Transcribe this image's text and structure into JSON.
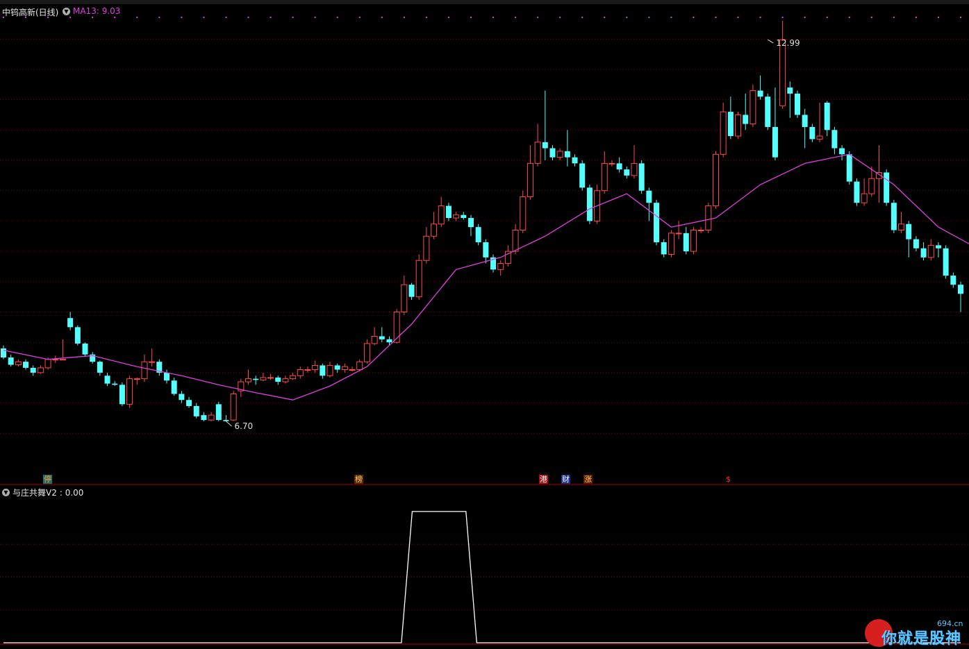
{
  "header": {
    "stock_name": "中钨高新(日线)",
    "ma_label": "MA13: 9.03"
  },
  "colors": {
    "up": "#ff4a4a",
    "down": "#54ffff",
    "ma": "#e040e0",
    "grid": "#8b0000",
    "indicator": "#ffffff"
  },
  "chart_data": [
    {
      "type": "candlestick",
      "series": [
        {
          "name": "MA13"
        }
      ],
      "ylim": [
        6.0,
        13.3
      ],
      "price_scale_step": 0.5,
      "annotations": [
        {
          "label": "12.99",
          "x_index": 103,
          "price": 12.99,
          "kind": "high"
        },
        {
          "label": "6.70",
          "x_index": 30,
          "price": 6.7,
          "kind": "low"
        }
      ],
      "candles": [
        [
          7.9,
          7.75,
          7.95,
          7.72
        ],
        [
          7.75,
          7.63,
          7.8,
          7.6
        ],
        [
          7.63,
          7.68,
          7.72,
          7.6
        ],
        [
          7.68,
          7.58,
          7.72,
          7.55
        ],
        [
          7.58,
          7.5,
          7.62,
          7.45
        ],
        [
          7.5,
          7.58,
          7.62,
          7.48
        ],
        [
          7.58,
          7.72,
          7.75,
          7.55
        ],
        [
          7.72,
          7.72,
          7.78,
          7.66
        ],
        [
          7.72,
          7.72,
          7.75,
          8.05
        ],
        [
          8.4,
          8.25,
          8.5,
          8.2
        ],
        [
          8.25,
          7.98,
          8.28,
          7.95
        ],
        [
          7.98,
          7.8,
          8.0,
          7.76
        ],
        [
          7.8,
          7.68,
          7.84,
          7.65
        ],
        [
          7.68,
          7.5,
          7.7,
          7.45
        ],
        [
          7.45,
          7.32,
          7.5,
          7.28
        ],
        [
          7.32,
          7.3,
          7.36,
          7.28
        ],
        [
          7.3,
          6.98,
          7.34,
          6.95
        ],
        [
          6.98,
          7.4,
          7.45,
          6.92
        ],
        [
          7.4,
          7.4,
          7.42,
          7.3
        ],
        [
          7.4,
          7.68,
          7.8,
          7.35
        ],
        [
          7.68,
          7.68,
          7.9,
          7.6
        ],
        [
          7.68,
          7.5,
          7.72,
          7.45
        ],
        [
          7.5,
          7.37,
          7.55,
          7.32
        ],
        [
          7.37,
          7.15,
          7.42,
          7.12
        ],
        [
          7.15,
          7.05,
          7.2,
          7.0
        ],
        [
          7.05,
          6.95,
          7.1,
          6.92
        ],
        [
          6.95,
          6.78,
          7.0,
          6.75
        ],
        [
          6.8,
          6.72,
          6.85,
          6.7
        ],
        [
          6.72,
          6.8,
          6.85,
          6.7
        ],
        [
          6.98,
          6.72,
          7.02,
          6.7
        ],
        [
          6.72,
          6.7,
          6.8,
          6.7
        ],
        [
          6.72,
          7.15,
          7.2,
          6.7
        ],
        [
          7.2,
          7.35,
          7.4,
          7.1
        ],
        [
          7.35,
          7.4,
          7.55,
          7.3
        ],
        [
          7.4,
          7.38,
          7.45,
          7.3
        ],
        [
          7.38,
          7.42,
          7.5,
          7.36
        ],
        [
          7.42,
          7.42,
          7.48,
          7.38
        ],
        [
          7.42,
          7.35,
          7.45,
          7.3
        ],
        [
          7.35,
          7.4,
          7.45,
          7.32
        ],
        [
          7.4,
          7.45,
          7.5,
          7.38
        ],
        [
          7.45,
          7.55,
          7.6,
          7.4
        ],
        [
          7.55,
          7.55,
          7.6,
          7.5
        ],
        [
          7.55,
          7.62,
          7.7,
          7.5
        ],
        [
          7.62,
          7.45,
          7.65,
          7.4
        ],
        [
          7.45,
          7.62,
          7.68,
          7.42
        ],
        [
          7.62,
          7.55,
          7.65,
          7.5
        ],
        [
          7.55,
          7.6,
          7.65,
          7.5
        ],
        [
          7.55,
          7.55,
          7.6,
          7.52
        ],
        [
          7.55,
          7.68,
          7.72,
          7.52
        ],
        [
          7.68,
          7.98,
          8.05,
          7.65
        ],
        [
          7.98,
          8.1,
          8.25,
          7.95
        ],
        [
          8.1,
          8.05,
          8.25,
          8.0
        ],
        [
          8.05,
          8.0,
          8.1,
          7.95
        ],
        [
          8.0,
          8.5,
          8.55,
          7.98
        ],
        [
          8.5,
          8.95,
          9.1,
          8.45
        ],
        [
          8.95,
          8.75,
          8.98,
          8.7
        ],
        [
          8.75,
          9.35,
          9.45,
          8.7
        ],
        [
          9.35,
          9.75,
          9.9,
          9.3
        ],
        [
          9.75,
          9.95,
          10.15,
          9.7
        ],
        [
          9.95,
          10.25,
          10.4,
          9.9
        ],
        [
          10.25,
          10.05,
          10.3,
          10.0
        ],
        [
          10.05,
          10.1,
          10.15,
          10.0
        ],
        [
          10.1,
          10.05,
          10.15,
          10.02
        ],
        [
          10.05,
          9.9,
          10.1,
          9.75
        ],
        [
          9.9,
          9.65,
          9.95,
          9.6
        ],
        [
          9.65,
          9.4,
          9.7,
          9.3
        ],
        [
          9.4,
          9.2,
          9.45,
          9.15
        ],
        [
          9.2,
          9.3,
          9.35,
          9.1
        ],
        [
          9.3,
          9.5,
          9.6,
          9.25
        ],
        [
          9.5,
          9.85,
          9.95,
          9.45
        ],
        [
          9.85,
          10.4,
          10.5,
          9.8
        ],
        [
          10.4,
          10.95,
          11.25,
          10.35
        ],
        [
          10.95,
          11.3,
          11.6,
          10.9
        ],
        [
          11.3,
          11.2,
          12.15,
          11.0
        ],
        [
          11.2,
          11.05,
          11.25,
          11.0
        ],
        [
          11.05,
          11.15,
          11.2,
          11.0
        ],
        [
          11.15,
          11.05,
          11.5,
          10.9
        ],
        [
          11.05,
          10.95,
          11.1,
          10.9
        ],
        [
          10.95,
          10.55,
          11.0,
          10.5
        ],
        [
          10.55,
          10.0,
          10.6,
          9.95
        ],
        [
          10.0,
          10.5,
          10.6,
          9.95
        ],
        [
          10.5,
          10.95,
          11.15,
          10.45
        ],
        [
          10.95,
          10.95,
          11.0,
          10.9
        ],
        [
          10.95,
          10.85,
          11.05,
          10.8
        ],
        [
          10.85,
          10.75,
          10.9,
          10.7
        ],
        [
          10.75,
          10.95,
          11.25,
          10.7
        ],
        [
          10.95,
          10.5,
          11.0,
          10.45
        ],
        [
          10.5,
          10.3,
          10.55,
          10.0
        ],
        [
          10.3,
          9.65,
          10.35,
          9.6
        ],
        [
          9.65,
          9.45,
          9.7,
          9.4
        ],
        [
          9.45,
          9.8,
          9.85,
          9.4
        ],
        [
          9.8,
          9.8,
          10.0,
          9.7
        ],
        [
          9.8,
          9.5,
          9.9,
          9.45
        ],
        [
          9.5,
          9.85,
          9.9,
          9.45
        ],
        [
          9.85,
          9.85,
          9.9,
          9.8
        ],
        [
          9.85,
          10.25,
          10.3,
          9.8
        ],
        [
          10.25,
          11.1,
          11.15,
          10.2
        ],
        [
          11.1,
          11.8,
          11.95,
          11.05
        ],
        [
          11.8,
          11.4,
          12.05,
          11.35
        ],
        [
          11.4,
          11.75,
          11.8,
          11.35
        ],
        [
          11.75,
          11.6,
          12.1,
          11.5
        ],
        [
          11.6,
          12.15,
          12.25,
          11.55
        ],
        [
          12.15,
          12.05,
          12.4,
          12.0
        ],
        [
          12.05,
          11.55,
          12.1,
          11.5
        ],
        [
          11.55,
          11.05,
          12.2,
          11.0
        ],
        [
          11.9,
          12.99,
          13.3,
          11.85
        ],
        [
          12.2,
          12.1,
          12.3,
          11.7
        ],
        [
          12.1,
          11.75,
          12.15,
          11.7
        ],
        [
          11.75,
          11.55,
          11.85,
          11.2
        ],
        [
          11.55,
          11.35,
          11.6,
          11.3
        ],
        [
          11.35,
          11.4,
          11.95,
          11.3
        ],
        [
          11.95,
          11.5,
          11.98,
          11.4
        ],
        [
          11.5,
          11.2,
          11.55,
          11.1
        ],
        [
          11.2,
          11.1,
          11.25,
          11.0
        ],
        [
          11.1,
          10.65,
          11.15,
          10.6
        ],
        [
          10.65,
          10.3,
          10.7,
          10.25
        ],
        [
          10.3,
          10.45,
          10.7,
          10.25
        ],
        [
          10.45,
          10.7,
          10.9,
          10.4
        ],
        [
          10.7,
          10.8,
          11.25,
          10.3
        ],
        [
          10.8,
          10.3,
          10.85,
          10.25
        ],
        [
          10.3,
          9.85,
          10.35,
          9.8
        ],
        [
          9.85,
          9.95,
          10.15,
          9.8
        ],
        [
          9.95,
          9.7,
          10.0,
          9.4
        ],
        [
          9.7,
          9.55,
          9.75,
          9.5
        ],
        [
          9.55,
          9.4,
          9.65,
          9.35
        ],
        [
          9.4,
          9.6,
          9.7,
          9.35
        ],
        [
          9.6,
          9.55,
          9.65,
          9.4
        ],
        [
          9.55,
          9.1,
          9.6,
          9.05
        ],
        [
          9.1,
          8.95,
          9.15,
          8.9
        ],
        [
          8.95,
          8.8,
          9.0,
          8.5
        ]
      ],
      "ma13": [
        [
          0,
          7.87
        ],
        [
          6,
          7.72
        ],
        [
          12,
          7.78
        ],
        [
          18,
          7.6
        ],
        [
          24,
          7.45
        ],
        [
          29,
          7.3
        ],
        [
          34,
          7.17
        ],
        [
          39,
          7.05
        ],
        [
          44,
          7.28
        ],
        [
          49,
          7.6
        ],
        [
          55,
          8.3
        ],
        [
          61,
          9.2
        ],
        [
          67,
          9.4
        ],
        [
          73,
          9.75
        ],
        [
          79,
          10.2
        ],
        [
          84,
          10.45
        ],
        [
          90,
          9.9
        ],
        [
          96,
          10.05
        ],
        [
          102,
          10.6
        ],
        [
          108,
          10.95
        ],
        [
          114,
          11.1
        ],
        [
          120,
          10.6
        ],
        [
          126,
          9.9
        ],
        [
          132,
          9.5
        ],
        [
          138,
          8.9
        ]
      ]
    },
    {
      "type": "line",
      "series": [
        {
          "name": "与庄共舞V2",
          "x": [
            0,
            74,
            76,
            86,
            88,
            178
          ],
          "y": [
            0,
            0,
            1,
            1,
            0,
            0
          ]
        }
      ],
      "ylim": [
        0,
        1.1
      ]
    }
  ],
  "indicator": {
    "name": "与庄共舞V2",
    "value_label": ": 0.00"
  },
  "signals": [
    {
      "text": "停",
      "color": "#ff9933",
      "bg": "#1d6e6e"
    },
    {
      "text": "榜",
      "color": "#ffcc66",
      "bg": "#5a2b00"
    },
    {
      "text": "港",
      "color": "#ffffff",
      "bg": "#aa1111"
    },
    {
      "text": "财",
      "color": "#ffffff",
      "bg": "#1a2e8c"
    },
    {
      "text": "涨",
      "color": "#ffcc66",
      "bg": "#5a1a00"
    },
    {
      "text": "$",
      "color": "#ff3030",
      "bg": "transparent"
    }
  ],
  "watermark": {
    "brand": "你就是股神",
    "url": "694.cn"
  }
}
